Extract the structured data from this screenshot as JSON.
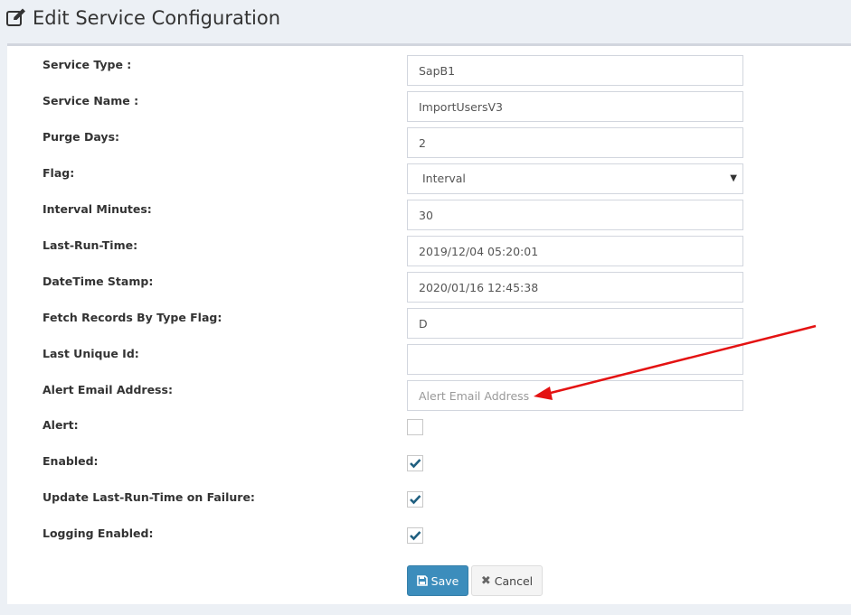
{
  "header": {
    "title": "Edit Service Configuration",
    "icon": "edit-icon"
  },
  "form": {
    "service_type": {
      "label": "Service Type :",
      "value": "SapB1"
    },
    "service_name": {
      "label": "Service Name :",
      "value": "ImportUsersV3"
    },
    "purge_days": {
      "label": "Purge Days:",
      "value": "2"
    },
    "flag": {
      "label": "Flag:",
      "selected": "Interval"
    },
    "interval_minutes": {
      "label": "Interval Minutes:",
      "value": "30"
    },
    "last_run_time": {
      "label": "Last-Run-Time:",
      "value": "2019/12/04 05:20:01"
    },
    "datetime_stamp": {
      "label": "DateTime Stamp:",
      "value": "2020/01/16 12:45:38"
    },
    "fetch_records": {
      "label": "Fetch Records By Type Flag:",
      "value": "D"
    },
    "last_unique_id": {
      "label": "Last Unique Id:",
      "value": ""
    },
    "alert_email": {
      "label": "Alert Email Address:",
      "value": "",
      "placeholder": "Alert Email Address"
    },
    "alert": {
      "label": "Alert:",
      "checked": false
    },
    "enabled": {
      "label": "Enabled:",
      "checked": true
    },
    "update_on_failure": {
      "label": "Update Last-Run-Time on Failure:",
      "checked": true
    },
    "logging_enabled": {
      "label": "Logging Enabled:",
      "checked": true
    }
  },
  "buttons": {
    "save": {
      "label": "Save",
      "icon": "save-icon"
    },
    "cancel": {
      "label": "Cancel",
      "icon": "close-icon"
    }
  },
  "colors": {
    "primary": "#3c8dbc",
    "check": "#1f5f80",
    "annotation_arrow": "#e41212"
  }
}
